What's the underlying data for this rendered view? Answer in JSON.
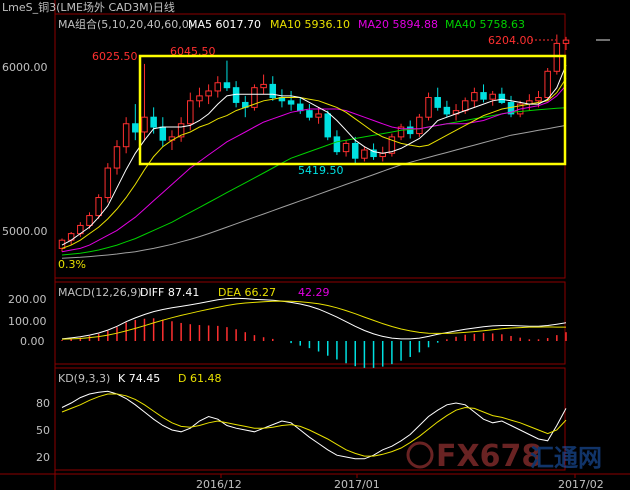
{
  "header": {
    "title": "LmeS_铜3(LME场外 CAD3M)日线"
  },
  "chart_data": [
    {
      "type": "candlestick",
      "panel": "price",
      "ma_label": "MA组合(5,10,20,40,60,0)",
      "ma_values": [
        {
          "name": "MA5",
          "value": "6017.70",
          "color": "#ffffff"
        },
        {
          "name": "MA10",
          "value": "5936.10",
          "color": "#e8e000"
        },
        {
          "name": "MA20",
          "value": "5894.88",
          "color": "#e000e0"
        },
        {
          "name": "MA40",
          "value": "5758.63",
          "color": "#00d000"
        }
      ],
      "ma60_color": "#a0a0a0",
      "y_ticks": [
        "6000.00",
        "5000.00"
      ],
      "y_tick_values": [
        6000,
        5000
      ],
      "annotations": [
        "6025.50",
        "6045.50",
        "5419.50",
        "6204.00"
      ],
      "corner_label": "0.3%",
      "box_color": "#ffff00",
      "up_color": "#ff3030",
      "down_color": "#00e0e0",
      "candles": [
        [
          4900,
          4960,
          4880,
          4950
        ],
        [
          4950,
          5000,
          4920,
          4990
        ],
        [
          4990,
          5060,
          4970,
          5040
        ],
        [
          5040,
          5120,
          5020,
          5100
        ],
        [
          5100,
          5230,
          5080,
          5210
        ],
        [
          5210,
          5420,
          5180,
          5390
        ],
        [
          5390,
          5560,
          5350,
          5520
        ],
        [
          5520,
          5700,
          5480,
          5660
        ],
        [
          5660,
          5780,
          5560,
          5610
        ],
        [
          5610,
          6025,
          5560,
          5700
        ],
        [
          5700,
          5760,
          5600,
          5640
        ],
        [
          5640,
          5700,
          5520,
          5560
        ],
        [
          5560,
          5620,
          5500,
          5580
        ],
        [
          5580,
          5700,
          5550,
          5660
        ],
        [
          5660,
          5850,
          5620,
          5800
        ],
        [
          5800,
          5880,
          5760,
          5830
        ],
        [
          5830,
          5900,
          5780,
          5860
        ],
        [
          5860,
          5950,
          5820,
          5910
        ],
        [
          5910,
          6045,
          5860,
          5880
        ],
        [
          5880,
          5920,
          5760,
          5790
        ],
        [
          5790,
          5830,
          5700,
          5760
        ],
        [
          5760,
          5900,
          5740,
          5880
        ],
        [
          5880,
          5960,
          5840,
          5900
        ],
        [
          5900,
          5950,
          5800,
          5820
        ],
        [
          5820,
          5870,
          5760,
          5800
        ],
        [
          5800,
          5860,
          5740,
          5780
        ],
        [
          5780,
          5820,
          5720,
          5740
        ],
        [
          5740,
          5780,
          5680,
          5700
        ],
        [
          5700,
          5760,
          5660,
          5720
        ],
        [
          5720,
          5740,
          5560,
          5580
        ],
        [
          5580,
          5620,
          5470,
          5490
        ],
        [
          5490,
          5560,
          5460,
          5540
        ],
        [
          5540,
          5580,
          5419,
          5450
        ],
        [
          5450,
          5520,
          5430,
          5500
        ],
        [
          5500,
          5540,
          5440,
          5460
        ],
        [
          5460,
          5520,
          5430,
          5480
        ],
        [
          5480,
          5600,
          5460,
          5580
        ],
        [
          5580,
          5660,
          5560,
          5640
        ],
        [
          5640,
          5680,
          5570,
          5600
        ],
        [
          5600,
          5720,
          5580,
          5700
        ],
        [
          5700,
          5850,
          5680,
          5820
        ],
        [
          5820,
          5880,
          5740,
          5760
        ],
        [
          5760,
          5800,
          5700,
          5720
        ],
        [
          5720,
          5780,
          5680,
          5740
        ],
        [
          5740,
          5820,
          5720,
          5800
        ],
        [
          5800,
          5880,
          5760,
          5850
        ],
        [
          5850,
          5900,
          5790,
          5810
        ],
        [
          5810,
          5860,
          5770,
          5840
        ],
        [
          5840,
          5880,
          5780,
          5790
        ],
        [
          5790,
          5830,
          5700,
          5720
        ],
        [
          5720,
          5800,
          5700,
          5780
        ],
        [
          5780,
          5840,
          5740,
          5800
        ],
        [
          5800,
          5860,
          5760,
          5820
        ],
        [
          5820,
          6000,
          5800,
          5980
        ],
        [
          5980,
          6204,
          5960,
          6150
        ],
        [
          6150,
          6190,
          6110,
          6170
        ]
      ],
      "ma5": [
        4920,
        4950,
        4990,
        5030,
        5090,
        5160,
        5270,
        5380,
        5480,
        5560,
        5630,
        5640,
        5640,
        5640,
        5650,
        5680,
        5720,
        5780,
        5830,
        5840,
        5840,
        5840,
        5840,
        5840,
        5830,
        5830,
        5820,
        5790,
        5760,
        5730,
        5680,
        5620,
        5560,
        5520,
        5490,
        5480,
        5490,
        5510,
        5540,
        5570,
        5620,
        5680,
        5700,
        5720,
        5740,
        5760,
        5780,
        5800,
        5810,
        5800,
        5790,
        5780,
        5780,
        5810,
        5880,
        6017
      ],
      "ma10": [
        4900,
        4920,
        4950,
        4990,
        5030,
        5080,
        5140,
        5210,
        5290,
        5380,
        5460,
        5520,
        5560,
        5590,
        5610,
        5640,
        5660,
        5690,
        5710,
        5740,
        5760,
        5780,
        5800,
        5810,
        5820,
        5820,
        5820,
        5810,
        5800,
        5780,
        5760,
        5730,
        5690,
        5650,
        5610,
        5580,
        5560,
        5540,
        5530,
        5520,
        5530,
        5560,
        5590,
        5620,
        5650,
        5680,
        5710,
        5730,
        5750,
        5760,
        5770,
        5780,
        5790,
        5800,
        5850,
        5936
      ],
      "ma20": [
        4880,
        4890,
        4900,
        4920,
        4950,
        4980,
        5010,
        5050,
        5090,
        5140,
        5190,
        5240,
        5290,
        5340,
        5390,
        5430,
        5470,
        5510,
        5550,
        5580,
        5610,
        5640,
        5670,
        5690,
        5710,
        5730,
        5740,
        5750,
        5750,
        5750,
        5750,
        5740,
        5720,
        5700,
        5680,
        5660,
        5640,
        5630,
        5630,
        5630,
        5640,
        5650,
        5660,
        5660,
        5660,
        5670,
        5680,
        5700,
        5720,
        5730,
        5750,
        5760,
        5770,
        5790,
        5830,
        5894
      ],
      "ma40": [
        4860,
        4865,
        4870,
        4880,
        4890,
        4905,
        4920,
        4940,
        4960,
        4985,
        5010,
        5035,
        5060,
        5090,
        5120,
        5150,
        5180,
        5210,
        5240,
        5270,
        5300,
        5330,
        5360,
        5390,
        5420,
        5450,
        5470,
        5490,
        5510,
        5530,
        5550,
        5560,
        5570,
        5580,
        5590,
        5600,
        5610,
        5620,
        5625,
        5630,
        5640,
        5650,
        5660,
        5670,
        5680,
        5690,
        5700,
        5710,
        5720,
        5730,
        5735,
        5740,
        5745,
        5750,
        5755,
        5758
      ],
      "ma60": [
        4840,
        4843,
        4846,
        4850,
        4855,
        4860,
        4866,
        4873,
        4880,
        4890,
        4900,
        4912,
        4925,
        4940,
        4955,
        4972,
        4990,
        5010,
        5030,
        5050,
        5070,
        5090,
        5110,
        5130,
        5150,
        5170,
        5190,
        5210,
        5230,
        5250,
        5270,
        5290,
        5310,
        5330,
        5350,
        5370,
        5390,
        5410,
        5425,
        5440,
        5455,
        5470,
        5485,
        5500,
        5515,
        5530,
        5545,
        5560,
        5575,
        5590,
        5600,
        5610,
        5620,
        5630,
        5640,
        5650
      ]
    },
    {
      "type": "bar",
      "panel": "macd",
      "label": "MACD(12,26,9)",
      "diff_label": "DIFF",
      "diff_value": "87.41",
      "dea_label": "DEA",
      "dea_value": "66.27",
      "macd_value": "42.29",
      "y_ticks": [
        "200.00",
        "100.00",
        "0.00"
      ],
      "y_tick_values": [
        200,
        100,
        0
      ],
      "diff": [
        10,
        15,
        20,
        28,
        38,
        52,
        70,
        92,
        110,
        126,
        140,
        150,
        158,
        165,
        172,
        180,
        188,
        196,
        202,
        204,
        202,
        198,
        196,
        194,
        190,
        184,
        176,
        166,
        152,
        134,
        114,
        92,
        70,
        50,
        34,
        22,
        14,
        10,
        10,
        14,
        22,
        32,
        40,
        48,
        56,
        62,
        68,
        72,
        74,
        74,
        72,
        70,
        70,
        74,
        80,
        87
      ],
      "dea": [
        8,
        10,
        12,
        16,
        21,
        28,
        37,
        48,
        60,
        73,
        86,
        99,
        111,
        122,
        132,
        142,
        151,
        160,
        169,
        176,
        181,
        184,
        187,
        189,
        190,
        189,
        187,
        183,
        177,
        169,
        158,
        145,
        130,
        114,
        98,
        83,
        69,
        57,
        48,
        41,
        37,
        36,
        36,
        38,
        41,
        45,
        49,
        54,
        58,
        62,
        64,
        66,
        66,
        67,
        66,
        66
      ]
    },
    {
      "type": "line",
      "panel": "kd",
      "label": "KD(9,3,3)",
      "k_label": "K",
      "k_value": "74.45",
      "d_label": "D",
      "d_value": "61.48",
      "y_ticks": [
        "80",
        "50",
        "20"
      ],
      "y_tick_values": [
        80,
        50,
        20
      ],
      "k": [
        75,
        80,
        86,
        90,
        92,
        93,
        90,
        85,
        78,
        70,
        62,
        55,
        50,
        48,
        52,
        60,
        65,
        62,
        55,
        52,
        50,
        48,
        52,
        56,
        60,
        58,
        50,
        42,
        35,
        28,
        22,
        20,
        18,
        18,
        22,
        28,
        32,
        38,
        45,
        55,
        65,
        72,
        78,
        80,
        78,
        70,
        62,
        58,
        60,
        55,
        50,
        45,
        40,
        38,
        55,
        74
      ],
      "d": [
        70,
        74,
        78,
        83,
        87,
        90,
        90,
        88,
        84,
        78,
        71,
        64,
        58,
        54,
        53,
        55,
        58,
        60,
        58,
        56,
        54,
        52,
        52,
        53,
        55,
        56,
        54,
        50,
        45,
        40,
        34,
        28,
        24,
        21,
        21,
        23,
        26,
        30,
        36,
        43,
        51,
        59,
        66,
        72,
        75,
        74,
        70,
        66,
        64,
        61,
        58,
        54,
        50,
        46,
        50,
        61
      ]
    }
  ],
  "x_axis": {
    "ticks": [
      "2016/12",
      "2017/01",
      "2017/02"
    ]
  },
  "watermark": {
    "text": "FX678",
    "sub": "汇通网"
  }
}
